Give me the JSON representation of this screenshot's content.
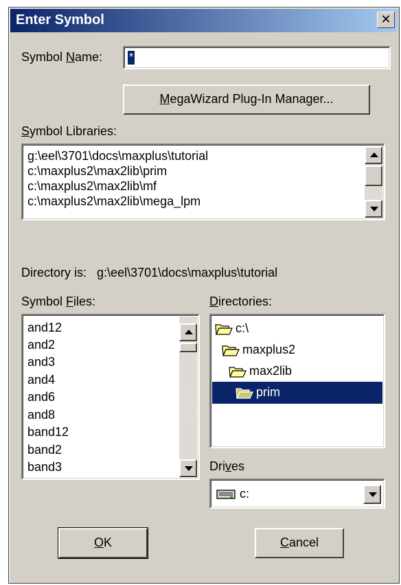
{
  "window": {
    "title": "Enter Symbol",
    "close_glyph": "✕"
  },
  "symbol_name": {
    "label_pre": "Symbol ",
    "label_u": "N",
    "label_post": "ame:",
    "value": "*"
  },
  "megawizard_button": {
    "u": "M",
    "rest": "egaWizard Plug-In Manager..."
  },
  "libraries": {
    "label_u": "S",
    "label_rest": "ymbol Libraries:",
    "items": [
      "g:\\eel\\3701\\docs\\maxplus\\tutorial",
      "c:\\maxplus2\\max2lib\\prim",
      "c:\\maxplus2\\max2lib\\mf",
      "c:\\maxplus2\\max2lib\\mega_lpm"
    ]
  },
  "directory": {
    "prefix": "Directory is:",
    "path": "g:\\eel\\3701\\docs\\maxplus\\tutorial"
  },
  "symbol_files": {
    "label_pre": "Symbol ",
    "label_u": "F",
    "label_post": "iles:",
    "items": [
      "and12",
      "and2",
      "and3",
      "and4",
      "and6",
      "and8",
      "band12",
      "band2",
      "band3"
    ]
  },
  "directories": {
    "label_u": "D",
    "label_rest": "irectories:",
    "items": [
      {
        "name": "c:\\",
        "icon": "open-folder-icon",
        "selected": false
      },
      {
        "name": "maxplus2",
        "icon": "open-folder-icon",
        "selected": false
      },
      {
        "name": "max2lib",
        "icon": "open-folder-icon",
        "selected": false
      },
      {
        "name": "prim",
        "icon": "open-folder-icon",
        "selected": true
      }
    ]
  },
  "drives": {
    "label_pre": "Dri",
    "label_u": "v",
    "label_post": "es",
    "value": "c:",
    "icon": "drive-icon"
  },
  "ok_button": {
    "u": "O",
    "rest": "K"
  },
  "cancel_button": {
    "u": "C",
    "rest": "ancel"
  },
  "colors": {
    "title_start": "#0a246a",
    "title_end": "#a6caf0",
    "face": "#d4d0c8",
    "selection": "#0a246a",
    "folder": "#ffff99"
  }
}
